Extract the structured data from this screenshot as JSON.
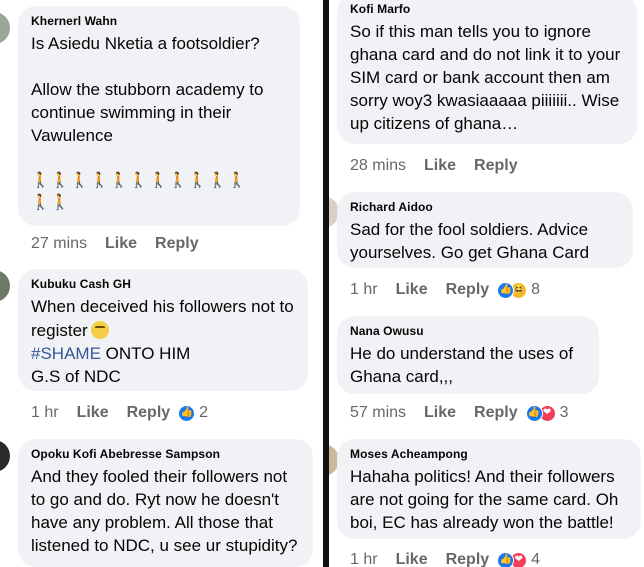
{
  "actions": {
    "like": "Like",
    "reply": "Reply"
  },
  "left": {
    "c1": {
      "author": "Khernerl Wahn",
      "line1": "Is Asiedu Nketia a footsoldier?",
      "line2": "Allow the stubborn academy to continue swimming in their Vawulence",
      "emoji_row1": "🚶🚶🚶🚶🚶🚶🚶🚶🚶🚶🚶",
      "emoji_row2": "🚶🚶",
      "time": "27 mins"
    },
    "c2": {
      "author": "Kubuku Cash GH",
      "line1": "When deceived his followers not to register",
      "hashtag": "#SHAME",
      "line2_rest": " ONTO HIM",
      "line3": "G.S of NDC",
      "time": "1 hr",
      "count": "2"
    },
    "c3": {
      "author": "Opoku Kofi Abebresse Sampson",
      "text": "And they fooled their followers not to go and do. Ryt now he doesn't have any problem. All those that listened to NDC, u see ur stupidity?"
    }
  },
  "right": {
    "c1": {
      "author": "Kofi Marfo",
      "text": "So if this man tells you to ignore ghana card and do not link it to your SIM card or bank account then am sorry woy3 kwasiaaaaa piiiiiii.. Wise up citizens of ghana…",
      "time": "28 mins"
    },
    "c2": {
      "author": "Richard Aidoo",
      "text": "Sad for the fool soldiers. Advice yourselves. Go get Ghana Card",
      "time": "1 hr",
      "count": "8"
    },
    "c3": {
      "author": "Nana Owusu",
      "text": "He do understand the uses of Ghana card,,,",
      "time": "57 mins",
      "count": "3"
    },
    "c4": {
      "author": "Moses Acheampong",
      "text": "Hahaha politics! And their followers are not going for the same card. Oh boi, EC has already won the battle!",
      "time": "1 hr",
      "count": "4"
    }
  }
}
